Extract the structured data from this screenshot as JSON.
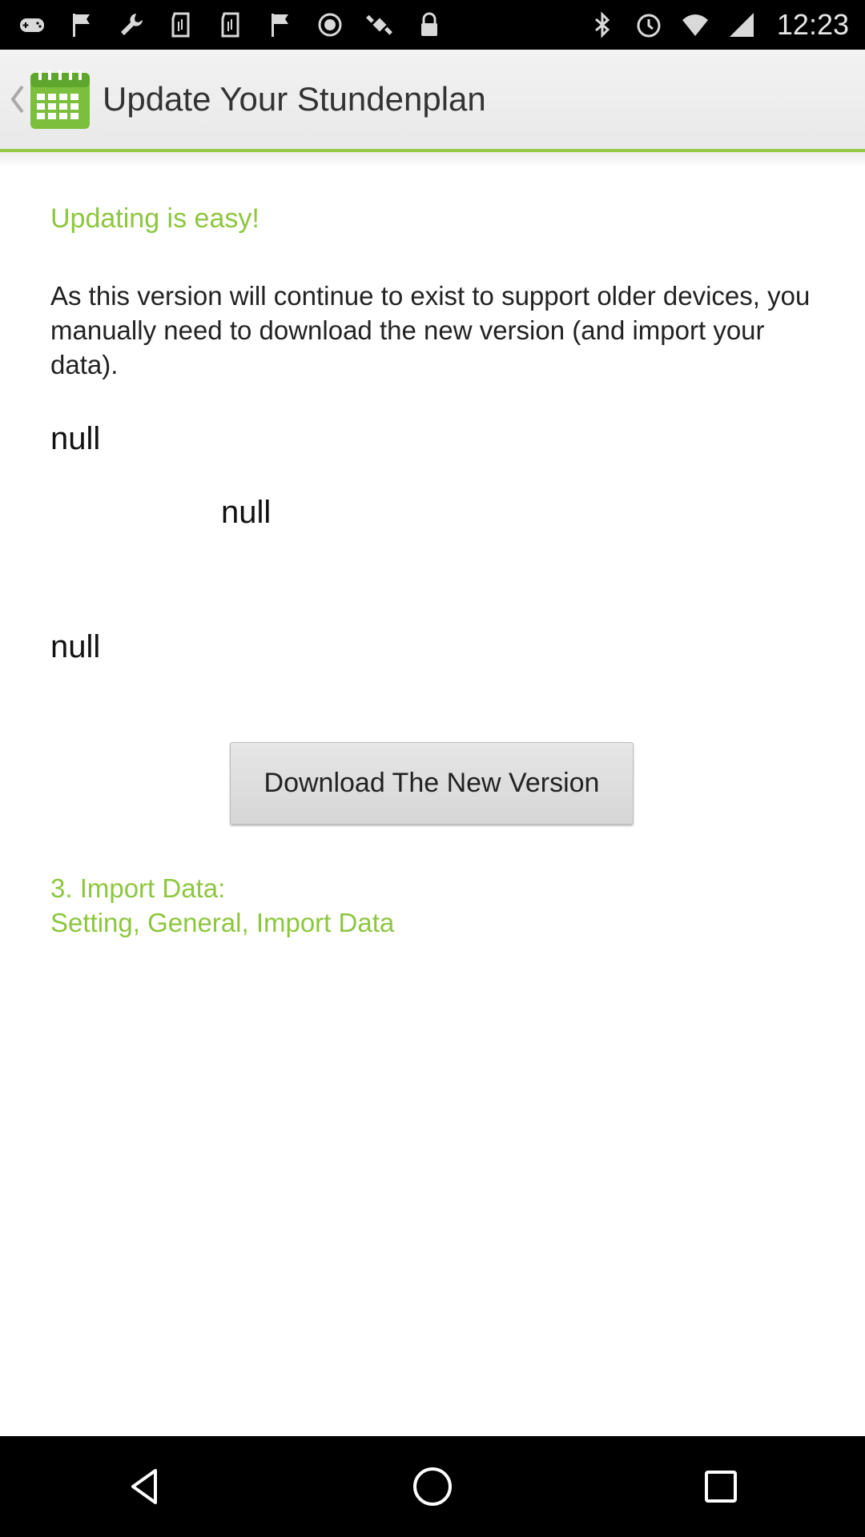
{
  "status_bar": {
    "time": "12:23",
    "left_icons": [
      "gamepad-icon",
      "flag-icon",
      "wrench-icon",
      "sd-card-icon",
      "sd-card-icon",
      "flag-icon",
      "circle-icon",
      "gps-icon",
      "lock-icon"
    ],
    "right_icons": [
      "bluetooth-icon",
      "alarm-icon",
      "wifi-icon",
      "signal-icon"
    ]
  },
  "action_bar": {
    "title": "Update Your Stundenplan",
    "app_icon": "calendar-icon",
    "accent_color": "#96c94a"
  },
  "content": {
    "heading": "Updating is easy!",
    "description": "As this version will continue to exist to support older devices, you manually need to download the new version (and import your data).",
    "null_1": "null",
    "null_2": "null",
    "null_3": "null",
    "download_button": "Download The New Version",
    "import_line1": "3. Import Data:",
    "import_line2": "Setting, General, Import Data",
    "green_color": "#8dc63f"
  },
  "nav_bar": {
    "buttons": [
      "back-icon",
      "home-icon",
      "recents-icon"
    ]
  }
}
